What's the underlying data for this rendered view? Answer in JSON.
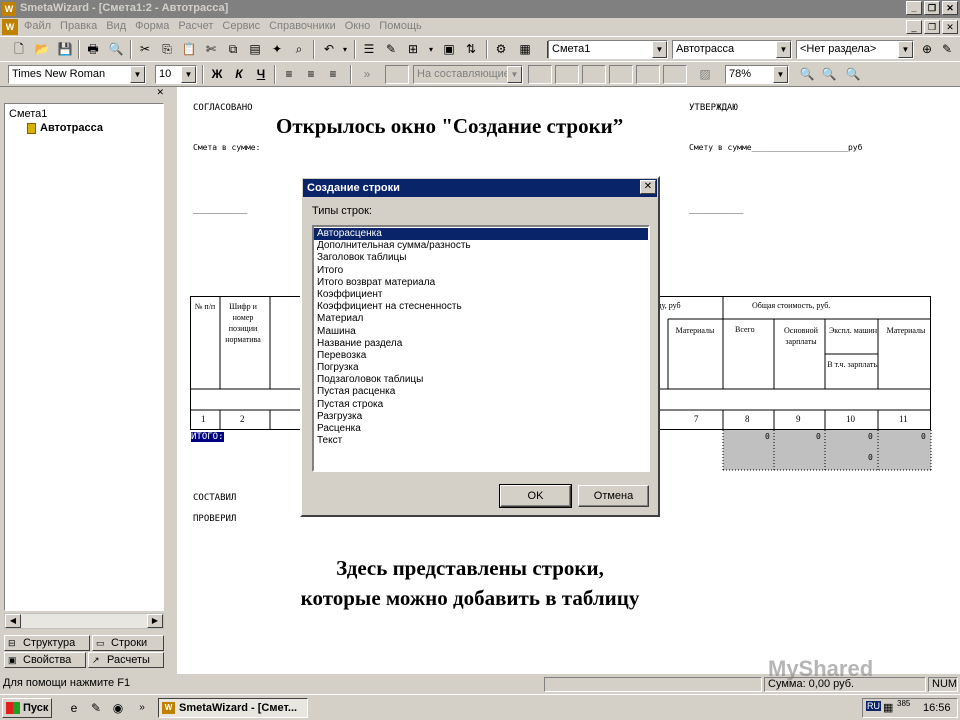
{
  "window": {
    "title": "SmetaWizard - [Смета1:2 - Автотрасса]",
    "app_icon_letter": "W"
  },
  "menu": {
    "items": [
      "Файл",
      "Правка",
      "Вид",
      "Форма",
      "Расчет",
      "Сервис",
      "Справочники",
      "Окно",
      "Помощь"
    ]
  },
  "toolbar1": {
    "smeta_combo": "Смета1",
    "object_combo": "Автотрасса",
    "section_combo": "<Нет раздела>"
  },
  "toolbar2": {
    "font_combo": "Times New Roman",
    "size_combo": "10",
    "bold_label": "Ж",
    "italic_label": "К",
    "underline_label": "Ч",
    "components_combo": "На составляющие",
    "zoom_combo": "78%"
  },
  "tree": {
    "root": "Смета1",
    "child": "Автотрасса"
  },
  "left_tabs": {
    "structure": "Структура",
    "rows": "Строки",
    "properties": "Свойства",
    "calcs": "Расчеты"
  },
  "document": {
    "agreed": "СОГЛАСОВАНО",
    "approve": "УТВЕРЖДАЮ",
    "smeta_sum_left": "Смета в сумме:",
    "smeta_sum_right": "Смету в сумме____________________руб",
    "sign_left": "__________",
    "sign_right": "__________",
    "table_headers": {
      "col1": "№ п/п",
      "col2": "Шифр и номер позиции норматива",
      "unit_cost": "...ицу, руб",
      "total_cost": "Общая стоимость, руб.",
      "materials": "Материалы",
      "total": "Всего",
      "salary": "Основной зарплаты",
      "machines": "Экспл. машин",
      "incl_salary": "В т.ч. зарплаты",
      "materials2": "Материалы"
    },
    "col_numbers": [
      "1",
      "2",
      "7",
      "8",
      "9",
      "10",
      "11"
    ],
    "total_label": "ИТОГО:",
    "total_values": [
      "0",
      "0",
      "0",
      "0"
    ],
    "total_value_extra": "0",
    "composed": "СОСТАВИЛ",
    "checked": "ПРОВЕРИЛ"
  },
  "overlay": {
    "title": "Открылось окно \"Создание строки”",
    "caption_line1": "Здесь представлены строки,",
    "caption_line2": "которые можно добавить в таблицу"
  },
  "dialog": {
    "title": "Создание строки",
    "label": "Типы строк:",
    "items": [
      "Авторасценка",
      "Дополнительная сумма/разность",
      "Заголовок таблицы",
      "Итого",
      "Итого возврат материала",
      "Коэффициент",
      "Коэффициент на стесненность",
      "Материал",
      "Машина",
      "Название раздела",
      "Перевозка",
      "Погрузка",
      "Подзаголовок таблицы",
      "Пустая расценка",
      "Пустая строка",
      "Разгрузка",
      "Расценка",
      "Текст"
    ],
    "selected_index": 0,
    "ok_label": "OK",
    "cancel_label": "Отмена"
  },
  "status": {
    "help": "Для помощи нажмите F1",
    "sum": "Сумма: 0,00 руб.",
    "num": "NUM"
  },
  "taskbar": {
    "start_label": "Пуск",
    "task_label": "SmetaWizard - [Смет...",
    "lang": "RU",
    "tray_num": "385",
    "clock": "16:56"
  },
  "watermark": "MyShared"
}
